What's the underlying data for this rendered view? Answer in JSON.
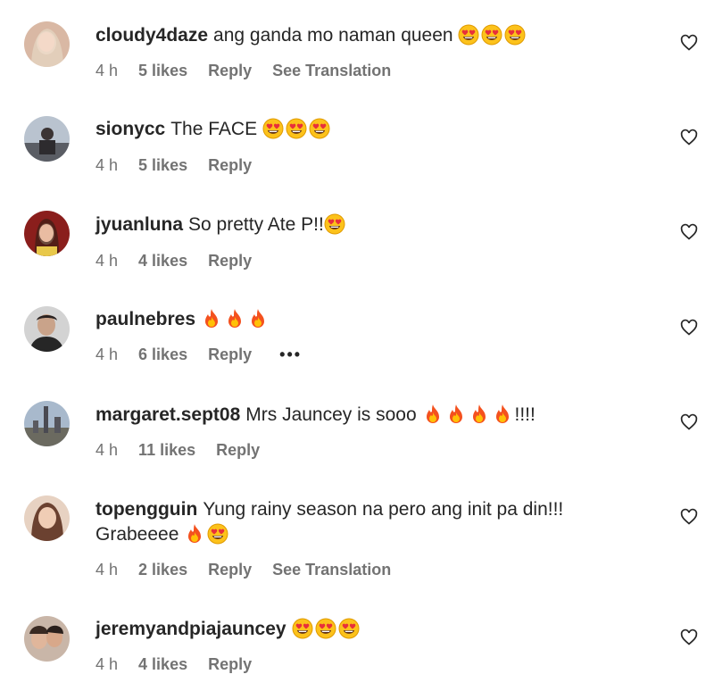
{
  "colors": {
    "text": "#262626",
    "meta": "#737373",
    "background": "#ffffff"
  },
  "icons": {
    "like": "heart-outline-icon",
    "heart_eyes": "heart-eyes-emoji",
    "fire": "fire-emoji",
    "more": "more-options-icon"
  },
  "comments": [
    {
      "username": "cloudy4daze",
      "text": "ang ganda mo naman queen",
      "emojis": [
        "heart_eyes",
        "heart_eyes",
        "heart_eyes"
      ],
      "suffix": "",
      "line2": "",
      "time": "4 h",
      "likes": "5 likes",
      "reply": "Reply",
      "translation": "See Translation"
    },
    {
      "username": "sionycc",
      "text": "The FACE",
      "emojis": [
        "heart_eyes",
        "heart_eyes",
        "heart_eyes"
      ],
      "suffix": "",
      "line2": "",
      "time": "4 h",
      "likes": "5 likes",
      "reply": "Reply",
      "translation": ""
    },
    {
      "username": "jyuanluna",
      "text": "So pretty Ate P!!",
      "emojis": [
        "heart_eyes"
      ],
      "suffix": "",
      "line2": "",
      "time": "4 h",
      "likes": "4 likes",
      "reply": "Reply",
      "translation": ""
    },
    {
      "username": "paulnebres",
      "text": "",
      "emojis": [
        "fire",
        "fire",
        "fire"
      ],
      "suffix": "",
      "line2": "",
      "time": "4 h",
      "likes": "6 likes",
      "reply": "Reply",
      "translation": "",
      "more": "•••"
    },
    {
      "username": "margaret.sept08",
      "text": "Mrs Jauncey is sooo",
      "emojis": [
        "fire",
        "fire",
        "fire",
        "fire"
      ],
      "suffix": "!!!!",
      "line2": "",
      "time": "4 h",
      "likes": "11 likes",
      "reply": "Reply",
      "translation": ""
    },
    {
      "username": "topengguin",
      "text": "Yung rainy season na pero ang init pa din!!!",
      "emojis": [],
      "suffix": "",
      "line2": "Grabeeee",
      "line2_emojis": [
        "fire",
        "heart_eyes"
      ],
      "time": "4 h",
      "likes": "2 likes",
      "reply": "Reply",
      "translation": "See Translation"
    },
    {
      "username": "jeremyandpiajauncey",
      "text": "",
      "emojis": [
        "heart_eyes",
        "heart_eyes",
        "heart_eyes"
      ],
      "suffix": "",
      "line2": "",
      "time": "4 h",
      "likes": "4 likes",
      "reply": "Reply",
      "translation": ""
    }
  ]
}
